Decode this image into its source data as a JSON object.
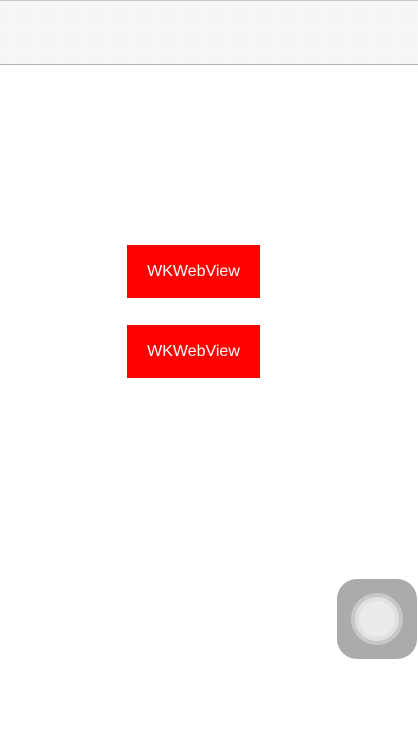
{
  "nav_bar": {
    "title": ""
  },
  "buttons": [
    {
      "label": "WKWebView"
    },
    {
      "label": "WKWebView"
    }
  ],
  "colors": {
    "button_background": "#ff0000",
    "button_text": "#ffffff",
    "nav_background": "#f7f7f7",
    "page_background": "#ffffff"
  },
  "assistive_touch": {
    "icon": "assistive-touch-icon"
  }
}
